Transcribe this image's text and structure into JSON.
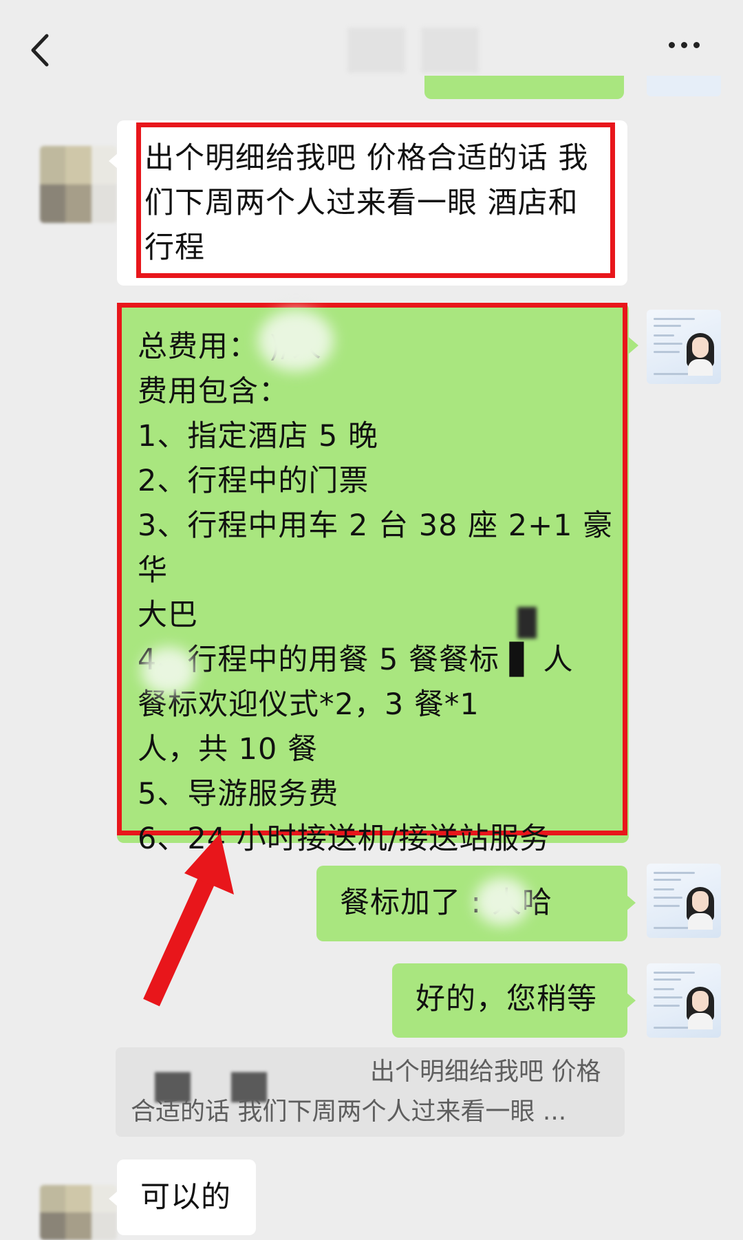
{
  "header": {
    "back_icon": "chevron-left-icon",
    "more_icon": "ellipsis-icon"
  },
  "messages": [
    {
      "id": "m1",
      "side": "left",
      "text": "出个明细给我吧 价格合适的话 我\n们下周两个人过来看一眼 酒店和\n行程",
      "highlighted": true
    },
    {
      "id": "m2",
      "side": "right",
      "lines": [
        "总费用：     )/人",
        "费用包含：",
        "1、指定酒店 5 晚",
        "2、行程中的门票",
        "3、行程中用车 2 台 38 座 2+1 豪华",
        "大巴",
        "4、行程中的用餐 5 餐餐标 ▋   人",
        "          餐标欢迎仪式*2，3 餐*1",
        "人，共 10 餐",
        "5、导游服务费",
        "6、24 小时接送机/接送站服务"
      ],
      "highlighted": true
    },
    {
      "id": "m3",
      "side": "right",
      "text": "餐标加了 :      人哈"
    },
    {
      "id": "m4",
      "side": "right",
      "text": "好的，您稍等"
    },
    {
      "id": "m5",
      "side": "quote",
      "line1": "出个明细给我吧 价格",
      "line2": "合适的话 我们下周两个人过来看一眼 ..."
    },
    {
      "id": "m6",
      "side": "left",
      "text": "可以的"
    }
  ],
  "colors": {
    "background": "#ededed",
    "green_bubble": "#a9e67f",
    "white_bubble": "#ffffff",
    "highlight_red": "#e8161b"
  }
}
